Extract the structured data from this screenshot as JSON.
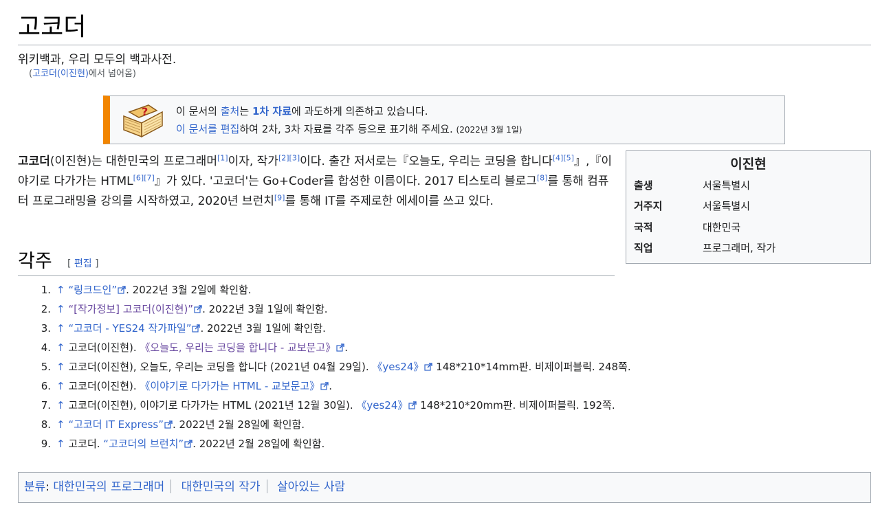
{
  "title": "고코더",
  "tagline": "위키백과, 우리 모두의 백과사전.",
  "redirect": {
    "open": "(",
    "link": "고코더(이진현)",
    "rest": "에서 넘어옴)"
  },
  "ambox": {
    "t1": "이 문서의 ",
    "link1": "출처",
    "t2": "는 ",
    "link2": "1차 자료",
    "t3": "에 과도하게 의존하고 있습니다.",
    "link3": "이 문서를 편집",
    "t4": "하여 2차, 3차 자료를 각주 등으로 표기해 주세요.",
    "date": "(2022년 3월 1일)"
  },
  "infobox": {
    "title": "이진현",
    "rows": [
      {
        "label": "출생",
        "value": "서울특별시"
      },
      {
        "label": "거주지",
        "value": "서울특별시"
      },
      {
        "label": "국적",
        "value": "대한민국"
      },
      {
        "label": "직업",
        "value": "프로그래머, 작가"
      }
    ]
  },
  "lead": {
    "bold": "고코더",
    "p1": "(이진현)는 대한민국의 프로그래머",
    "s1": "[1]",
    "p2": "이자, 작가",
    "s2": "[2]",
    "s3": "[3]",
    "p3": "이다. 출간 저서로는『오늘도, 우리는 코딩을 합니다",
    "s4": "[4]",
    "s5": "[5]",
    "p4": "』,『이야기로 다가가는 HTML",
    "s6": "[6]",
    "s7": "[7]",
    "p5": "』가 있다. '고코더'는 Go+Coder를 합성한 이름이다. 2017 티스토리 블로그",
    "s8": "[8]",
    "p6": "를 통해 컴퓨터 프로그래밍을 강의를 시작하였고, 2020년 브런치",
    "s9": "[9]",
    "p7": "를 통해 IT를 주제로한 에세이를 쓰고 있다."
  },
  "section": {
    "title": "각주",
    "edit_open": "[ ",
    "edit": "편집",
    "edit_close": " ]"
  },
  "refs": [
    {
      "num": "1.",
      "arrow": "↑",
      "pre": "",
      "link": "“링크드인”",
      "post": ". 2022년 3월 2일에 확인함."
    },
    {
      "num": "2.",
      "arrow": "↑",
      "pre": "",
      "link": "“[작가정보] 고코더(이진현)”",
      "post": ". 2022년 3월 1일에 확인함."
    },
    {
      "num": "3.",
      "arrow": "↑",
      "pre": "",
      "link": "“고코더 - YES24 작가파일”",
      "post": ". 2022년 3월 1일에 확인함."
    },
    {
      "num": "4.",
      "arrow": "↑",
      "pre": "고코더(이진현). ",
      "link": "《오늘도, 우리는 코딩을 합니다 - 교보문고》",
      "post": "."
    },
    {
      "num": "5.",
      "arrow": "↑",
      "pre": "고코더(이진현), 오늘도, 우리는 코딩을 합니다 (2021년 04월 29일). ",
      "link": "《yes24》",
      "post": " 148*210*14mm판. 비제이퍼블릭. 248쪽."
    },
    {
      "num": "6.",
      "arrow": "↑",
      "pre": "고코더(이진현). ",
      "link": "《이야기로 다가가는 HTML - 교보문고》",
      "post": "."
    },
    {
      "num": "7.",
      "arrow": "↑",
      "pre": "고코더(이진현), 이야기로 다가가는 HTML (2021년 12월 30일). ",
      "link": "《yes24》",
      "post": " 148*210*20mm판. 비제이퍼블릭. 192쪽."
    },
    {
      "num": "8.",
      "arrow": "↑",
      "pre": "",
      "link": "“고코더 IT Express”",
      "post": ". 2022년 2월 28일에 확인함."
    },
    {
      "num": "9.",
      "arrow": "↑",
      "pre": "고코더. ",
      "link": "“고코더의 브런치”",
      "post": ". 2022년 2월 28일에 확인함."
    }
  ],
  "categories": {
    "label": "분류",
    "colon": ": ",
    "items": [
      "대한민국의 프로그래머",
      "대한민국의 작가",
      "살아있는 사람"
    ]
  }
}
